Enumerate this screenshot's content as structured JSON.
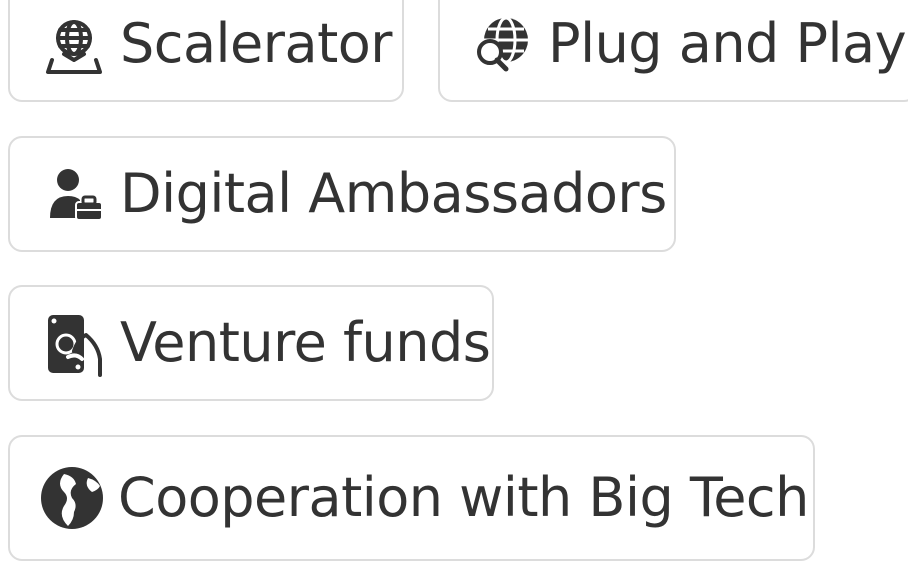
{
  "chips": [
    {
      "label": "Scalerator",
      "icon": "globe-stand-icon"
    },
    {
      "label": "Plug and Play",
      "icon": "globe-search-icon"
    },
    {
      "label": "Digital Ambassadors",
      "icon": "person-briefcase-icon"
    },
    {
      "label": "Venture funds",
      "icon": "money-hand-icon"
    },
    {
      "label": "Cooperation with Big Tech",
      "icon": "earth-icon"
    }
  ],
  "colors": {
    "text": "#333333",
    "border": "#dcdcdc",
    "icon": "#333333",
    "background": "#ffffff"
  }
}
